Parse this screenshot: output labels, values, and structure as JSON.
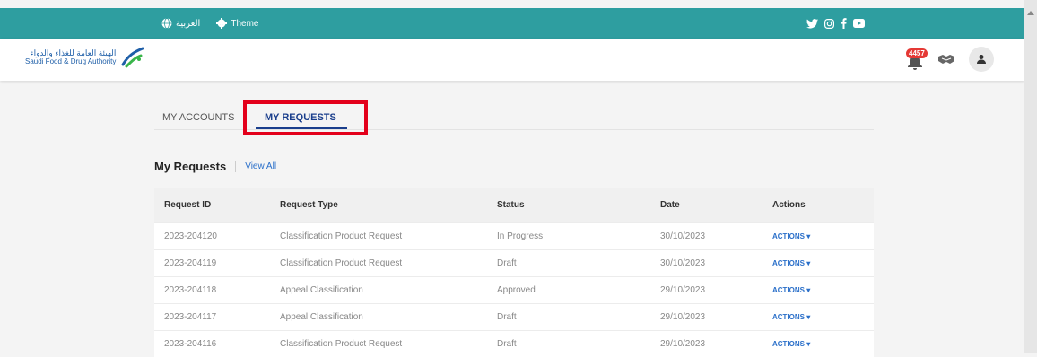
{
  "topbar": {
    "language_label": "العربية",
    "theme_label": "Theme",
    "social_icons": [
      "twitter-icon",
      "instagram-icon",
      "facebook-icon",
      "youtube-icon"
    ],
    "color": "#2e9ea0"
  },
  "header": {
    "logo_arabic": "الهيئة العامة للغذاء والدواء",
    "logo_english": "Saudi Food & Drug Authority",
    "notification_count": "4457"
  },
  "tabs": [
    {
      "label": "MY ACCOUNTS",
      "active": false
    },
    {
      "label": "MY REQUESTS",
      "active": true
    }
  ],
  "section": {
    "title": "My Requests",
    "view_all": "View All"
  },
  "table": {
    "headers": [
      "Request ID",
      "Request Type",
      "Status",
      "Date",
      "Actions"
    ],
    "rows": [
      [
        "2023-204120",
        "Classification Product Request",
        "In Progress",
        "30/10/2023",
        "ACTIONS ▾"
      ],
      [
        "2023-204119",
        "Classification Product Request",
        "Draft",
        "30/10/2023",
        "ACTIONS ▾"
      ],
      [
        "2023-204118",
        "Appeal Classification",
        "Approved",
        "29/10/2023",
        "ACTIONS ▾"
      ],
      [
        "2023-204117",
        "Appeal Classification",
        "Draft",
        "29/10/2023",
        "ACTIONS ▾"
      ],
      [
        "2023-204116",
        "Classification Product Request",
        "Draft",
        "29/10/2023",
        "ACTIONS ▾"
      ]
    ]
  },
  "colors": {
    "accent": "#1a3e8c",
    "link": "#2a6fc9",
    "highlight": "#e3001b"
  }
}
